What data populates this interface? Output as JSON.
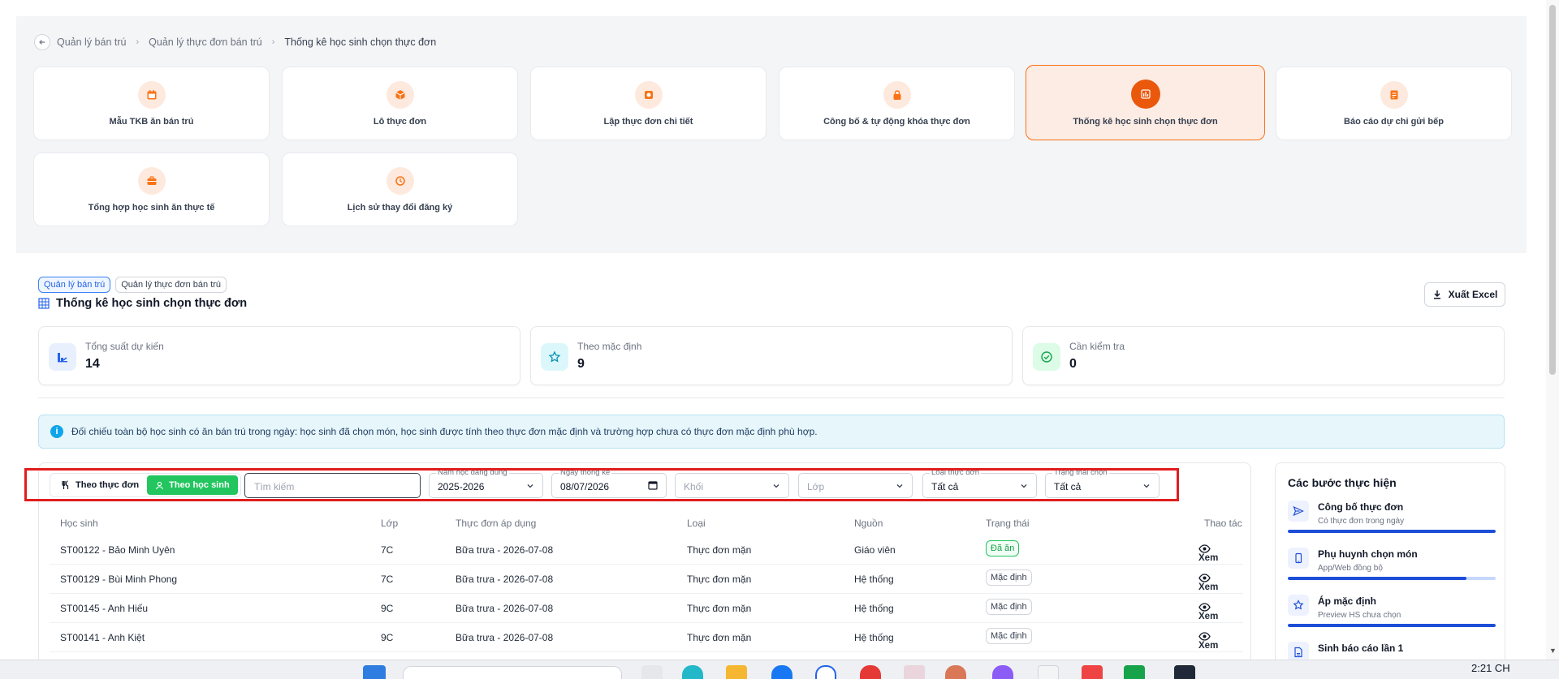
{
  "breadcrumb": {
    "back_icon": "arrow-left-icon",
    "items": [
      "Quản lý bán trú",
      "Quản lý thực đơn bán trú",
      "Thống kê học sinh chọn thực đơn"
    ],
    "separator": "›"
  },
  "modules": [
    {
      "label": "Mẫu TKB ăn bán trú",
      "icon": "calendar-icon",
      "active": false
    },
    {
      "label": "Lô thực đơn",
      "icon": "box-icon",
      "active": false
    },
    {
      "label": "Lập thực đơn chi tiết",
      "icon": "recipe-icon",
      "active": false
    },
    {
      "label": "Công bố & tự động khóa thực đơn",
      "icon": "lock-icon",
      "active": false
    },
    {
      "label": "Thống kê học sinh chọn thực đơn",
      "icon": "bar-chart-icon",
      "active": true
    },
    {
      "label": "Báo cáo dự chi gửi bếp",
      "icon": "report-icon",
      "active": false
    },
    {
      "label": "Tổng hợp học sinh ăn thực tế",
      "icon": "briefcase-icon",
      "active": false
    },
    {
      "label": "Lịch sử thay đổi đăng ký",
      "icon": "history-icon",
      "active": false
    }
  ],
  "header": {
    "tags": [
      "Quản lý bán trú",
      "Quản lý thực đơn bán trú"
    ],
    "title": "Thống kê học sinh chọn thực đơn",
    "title_icon": "table-grid-icon",
    "export_label": "Xuất Excel",
    "export_icon": "download-icon"
  },
  "stats": [
    {
      "label": "Tổng suất dự kiến",
      "value": "14",
      "icon": "chart-icon",
      "color": "#2563eb",
      "bg": "#e8f0fe"
    },
    {
      "label": "Theo mặc định",
      "value": "9",
      "icon": "star-icon",
      "color": "#0891b2",
      "bg": "#dcf7fb"
    },
    {
      "label": "Cần kiểm tra",
      "value": "0",
      "icon": "check-circle-icon",
      "color": "#16a34a",
      "bg": "#dcfce7"
    }
  ],
  "info_banner": {
    "icon": "info-icon",
    "text": "Đối chiếu toàn bộ học sinh có ăn bán trú trong ngày: học sinh đã chọn món, học sinh được tính theo thực đơn mặc định và trường hợp chưa có thực đơn mặc định phù hợp."
  },
  "filters": {
    "view_by_menu": "Theo thực đơn",
    "view_by_student": "Theo học sinh",
    "active_view": "student",
    "search_placeholder": "Tìm kiếm",
    "year_label": "Năm học đang dùng",
    "year_value": "2025-2026",
    "date_label": "Ngày thống kê",
    "date_value": "08/07/2026",
    "grade_placeholder": "Khối",
    "class_placeholder": "Lớp",
    "menu_type_label": "Loại thực đơn",
    "menu_type_value": "Tất cả",
    "status_label": "Trạng thái chọn",
    "status_value": "Tất cả"
  },
  "table": {
    "columns": [
      "Học sinh",
      "Lớp",
      "Thực đơn áp dụng",
      "Loại",
      "Nguồn",
      "Trạng thái",
      "Thao tác"
    ],
    "rows": [
      {
        "student": "ST00122 - Bảo Minh Uyên",
        "class": "7C",
        "menu": "Bữa trưa - 2026-07-08",
        "type": "Thực đơn mặn",
        "source": "Giáo viên",
        "status": "Đã ăn",
        "status_kind": "green",
        "action": "Xem"
      },
      {
        "student": "ST00129 - Bùi Minh Phong",
        "class": "7C",
        "menu": "Bữa trưa - 2026-07-08",
        "type": "Thực đơn mặn",
        "source": "Hệ thống",
        "status": "Mặc định",
        "status_kind": "default",
        "action": "Xem"
      },
      {
        "student": "ST00145 - Anh Hiếu",
        "class": "9C",
        "menu": "Bữa trưa - 2026-07-08",
        "type": "Thực đơn mặn",
        "source": "Hệ thống",
        "status": "Mặc định",
        "status_kind": "default",
        "action": "Xem"
      },
      {
        "student": "ST00141 - Anh Kiệt",
        "class": "9C",
        "menu": "Bữa trưa - 2026-07-08",
        "type": "Thực đơn mặn",
        "source": "Hệ thống",
        "status": "Mặc định",
        "status_kind": "default",
        "action": "Xem"
      }
    ]
  },
  "steps": {
    "title": "Các bước thực hiện",
    "items": [
      {
        "title": "Công bố thực đơn",
        "desc": "Có thực đơn trong ngày",
        "icon": "send-icon",
        "progress": 1.0
      },
      {
        "title": "Phụ huynh chọn món",
        "desc": "App/Web đồng bộ",
        "icon": "phone-icon",
        "progress": 0.86
      },
      {
        "title": "Áp mặc định",
        "desc": "Preview HS chưa chọn",
        "icon": "star-icon",
        "progress": 1.0
      },
      {
        "title": "Sinh báo cáo lần 1",
        "desc": "",
        "icon": "file-icon",
        "progress": 0
      }
    ]
  },
  "taskbar": {
    "clock": "2:21 CH"
  }
}
